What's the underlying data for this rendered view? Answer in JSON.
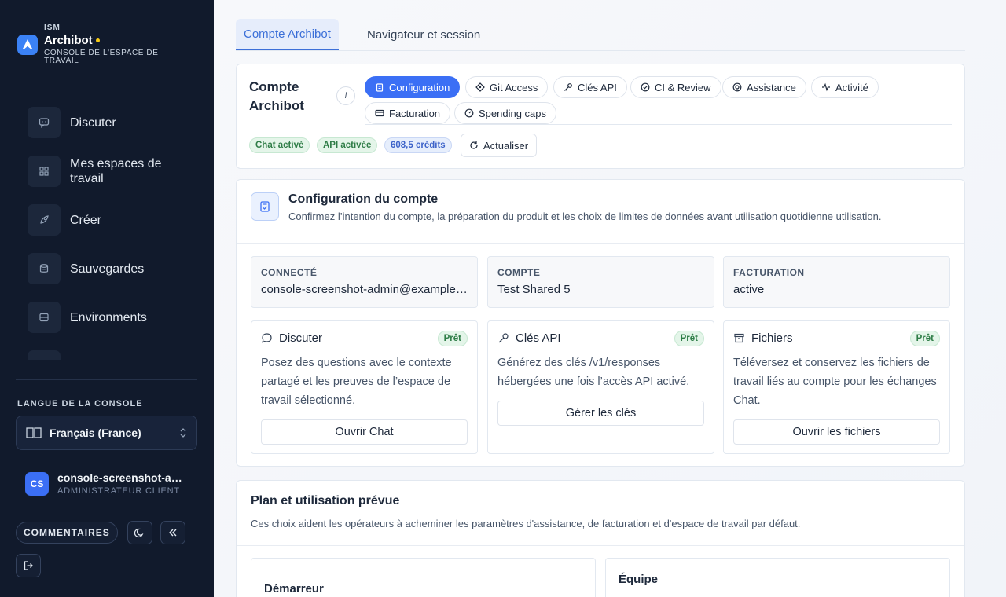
{
  "brand": {
    "org": "ISM",
    "name": "Archibot",
    "subtitle": "CONSOLE DE L'ESPACE DE TRAVAIL"
  },
  "sidebar": {
    "items": [
      {
        "label": "Discuter",
        "icon": "chat-icon"
      },
      {
        "label": "Mes espaces de travail",
        "icon": "grid-icon"
      },
      {
        "label": "Créer",
        "icon": "rocket-icon"
      },
      {
        "label": "Sauvegardes",
        "icon": "database-icon"
      },
      {
        "label": "Environments",
        "icon": "server-icon"
      }
    ],
    "language_title": "LANGUE DE LA CONSOLE",
    "language_value": "Français (France)",
    "user_initials": "CS",
    "user_name": "console-screenshot-admin@example.com",
    "user_role": "ADMINISTRATEUR CLIENT",
    "feedback_label": "COMMENTAIRES"
  },
  "tabs": {
    "active": "Compte Archibot",
    "inactive": "Navigateur et session"
  },
  "account": {
    "title": "Compte Archibot",
    "info_label": "i",
    "subtabs": [
      "Configuration",
      "Git Access",
      "Clés API",
      "CI & Review",
      "Assistance",
      "Activité",
      "Facturation",
      "Spending caps"
    ],
    "badges": [
      "Chat activé",
      "API activée",
      "608,5 crédits"
    ],
    "refresh_label": "Actualiser"
  },
  "config": {
    "title": "Configuration du compte",
    "description": "Confirmez l’intention du compte, la préparation du produit et les choix de limites de données avant utilisation quotidienne utilisation.",
    "info": [
      {
        "label": "CONNECTÉ",
        "value": "console-screenshot-admin@example.com"
      },
      {
        "label": "COMPTE",
        "value": "Test Shared 5"
      },
      {
        "label": "FACTURATION",
        "value": "active"
      }
    ],
    "features": [
      {
        "title": "Discuter",
        "status": "Prêt",
        "description": "Posez des questions avec le contexte partagé et les preuves de l’espace de travail sélectionné.",
        "button": "Ouvrir Chat"
      },
      {
        "title": "Clés API",
        "status": "Prêt",
        "description": "Générez des clés /v1/responses hébergées une fois l’accès API activé.",
        "button": "Gérer les clés"
      },
      {
        "title": "Fichiers",
        "status": "Prêt",
        "description": "Téléversez et conservez les fichiers de travail liés au compte pour les échanges Chat.",
        "button": "Ouvrir les fichiers"
      }
    ]
  },
  "plan": {
    "title": "Plan et utilisation prévue",
    "description": "Ces choix aident les opérateurs à acheminer les paramètres d'assistance, de facturation et d'espace de travail par défaut.",
    "options": [
      "Démarreur",
      "Équipe"
    ]
  },
  "colors": {
    "accent": "#3b6ff5",
    "sidebar_bg": "#111a2c",
    "ready_green": "#2f7d47"
  }
}
